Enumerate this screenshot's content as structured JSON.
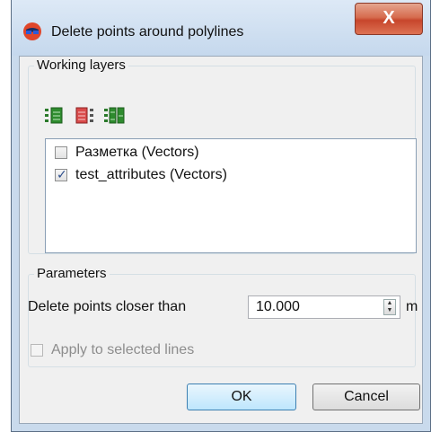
{
  "window": {
    "title": "Delete points around polylines",
    "close_label": "X",
    "app_icon": "3d-glasses-icon"
  },
  "working_layers": {
    "label": "Working layers",
    "toolbar": [
      {
        "name": "select-all-icon"
      },
      {
        "name": "deselect-all-icon"
      },
      {
        "name": "invert-selection-icon"
      }
    ],
    "layers": [
      {
        "label": "Разметка (Vectors)",
        "checked": false
      },
      {
        "label": "test_attributes (Vectors)",
        "checked": true
      }
    ]
  },
  "parameters": {
    "label": "Parameters",
    "delete_label": "Delete points closer than",
    "distance_value": "10.000",
    "unit": "m",
    "apply_selected_label": "Apply to selected lines",
    "apply_selected_checked": false,
    "apply_selected_enabled": false
  },
  "buttons": {
    "ok": "OK",
    "cancel": "Cancel"
  },
  "colors": {
    "title_bg": "#c9daec",
    "close_red": "#c7462c",
    "ok_border": "#3c7fb1"
  }
}
